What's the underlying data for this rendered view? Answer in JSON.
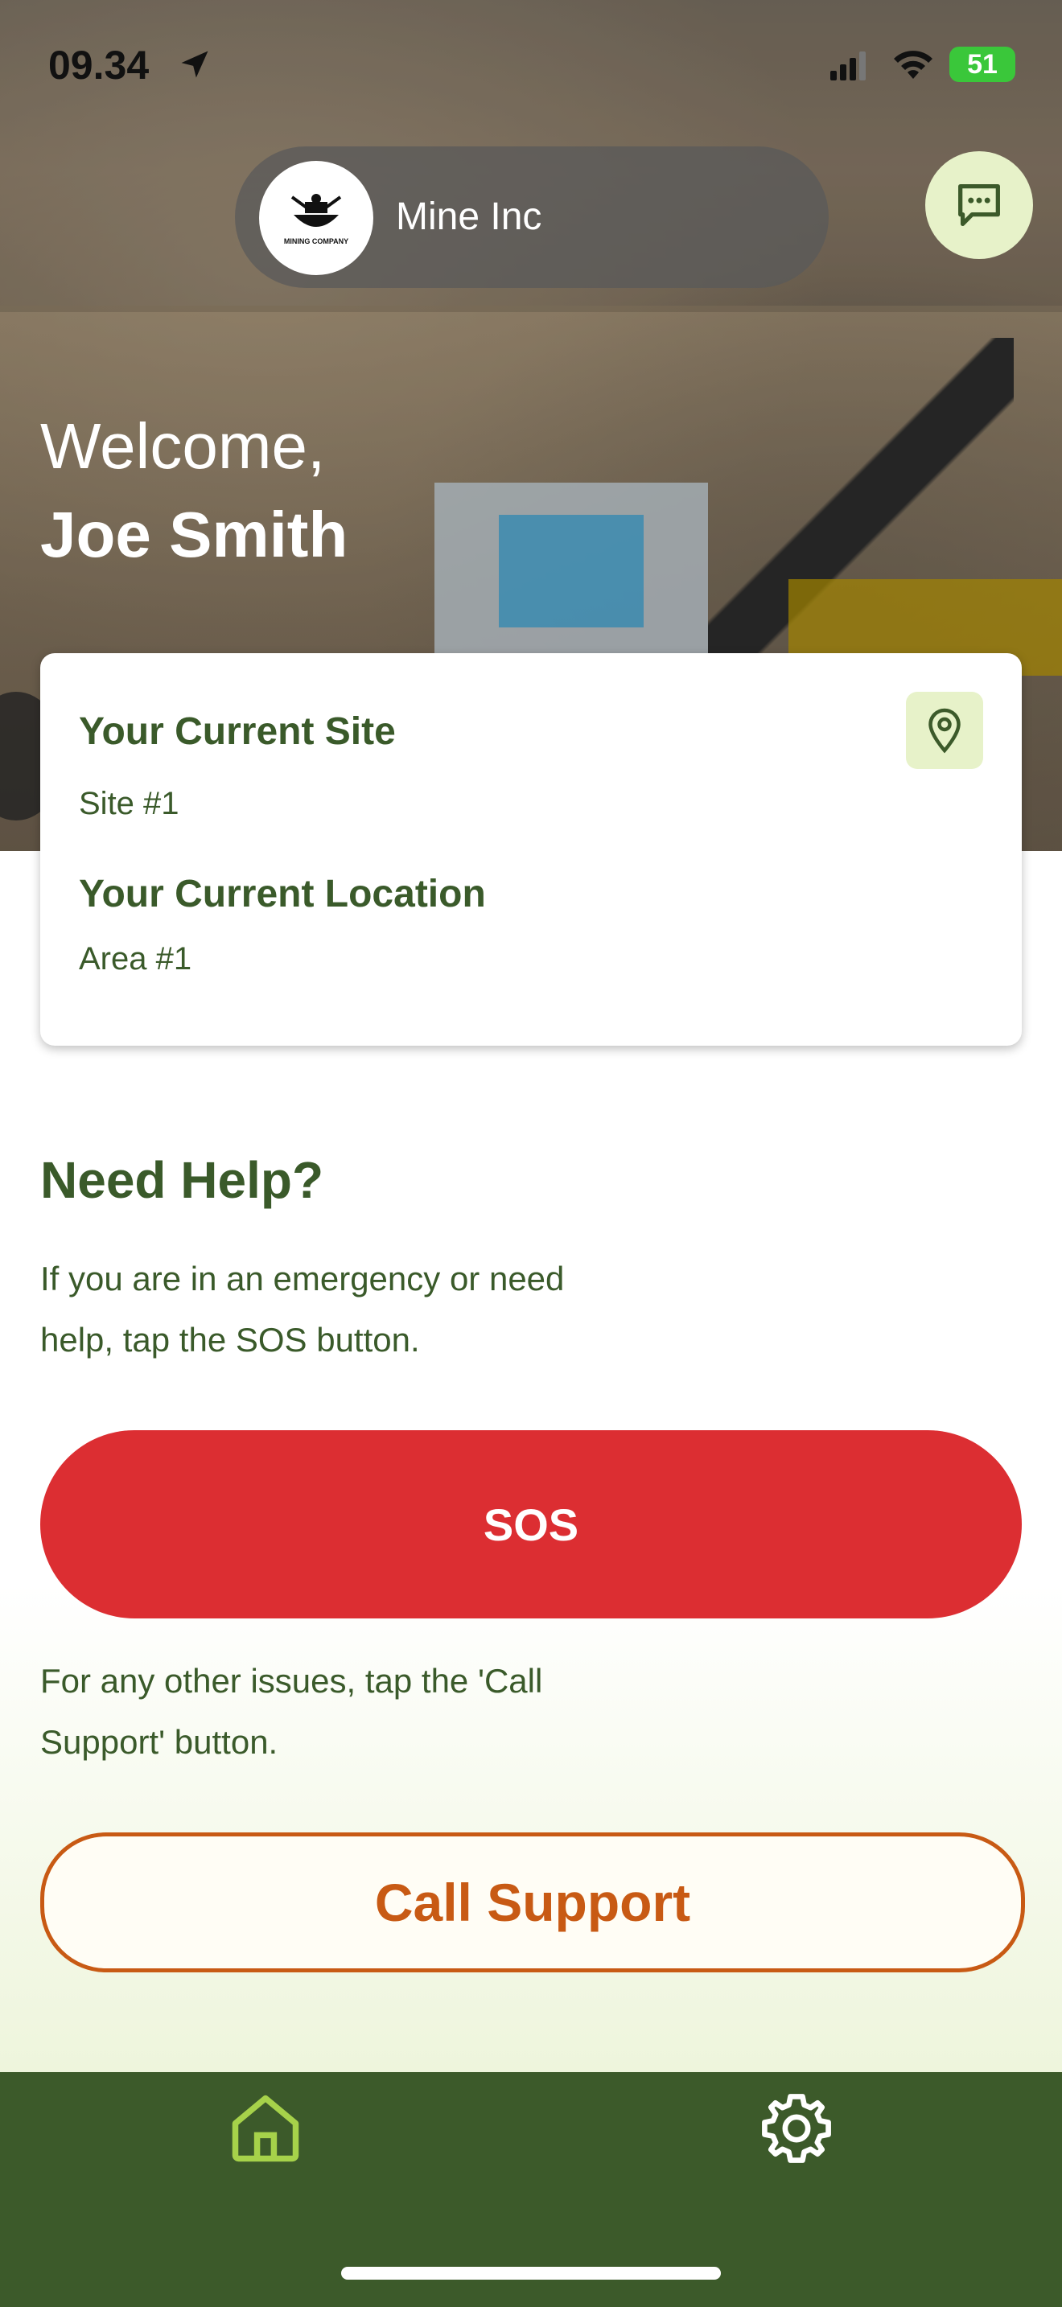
{
  "status_bar": {
    "time": "09.34",
    "battery": "51"
  },
  "header": {
    "company_name": "Mine Inc",
    "logo_text": "MINING COMPANY"
  },
  "welcome": {
    "greeting": "Welcome,",
    "user_name": "Joe Smith"
  },
  "card": {
    "site_title": "Your Current Site",
    "site_value": "Site #1",
    "location_title": "Your Current Location",
    "location_value": "Area #1"
  },
  "help": {
    "title": "Need Help?",
    "text": "If you are in an emergency or need help, tap the SOS button.",
    "sos_label": "SOS",
    "other_text": "For any other issues, tap the 'Call Support' button.",
    "call_label": "Call Support"
  },
  "colors": {
    "primary_green": "#3c5a2a",
    "sos_red": "#dc2e32",
    "call_orange": "#c85a14",
    "accent_light": "#e7f2c9"
  },
  "icons": {
    "chat": "chat-bubble-icon",
    "pin": "location-pin-icon",
    "home": "home-icon",
    "settings": "gear-icon"
  }
}
